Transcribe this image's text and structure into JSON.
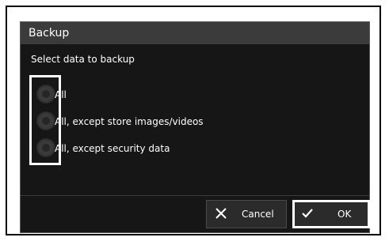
{
  "dialog": {
    "title": "Backup",
    "subtitle": "Select data to backup",
    "options": [
      {
        "label": "All"
      },
      {
        "label": "All, except store images/videos"
      },
      {
        "label": "All, except security data"
      }
    ],
    "cancel_label": "Cancel",
    "ok_label": "OK",
    "cancel_icon": "close-icon",
    "ok_icon": "checkmark-icon"
  },
  "colors": {
    "dialog_background": "#161616",
    "title_bar": "#3b3b3b",
    "text": "#ffffff",
    "highlight": "#ffffff"
  }
}
